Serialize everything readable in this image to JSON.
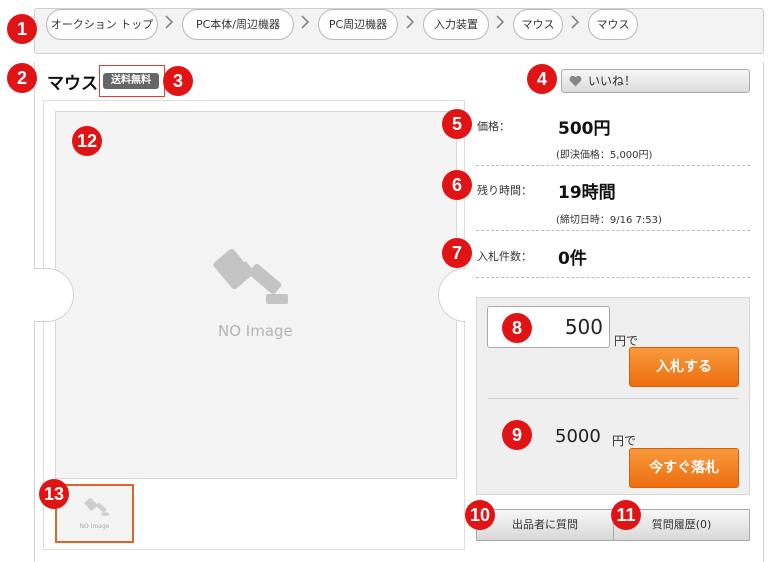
{
  "breadcrumb": [
    {
      "label": "オークション トップ"
    },
    {
      "label": "PC本体/周辺機器"
    },
    {
      "label": "PC周辺機器"
    },
    {
      "label": "入力装置"
    },
    {
      "label": "マウス"
    },
    {
      "label": "マウス"
    }
  ],
  "item": {
    "title": "マウス",
    "free_shipping_badge": "送料無料",
    "like_label": "いいね！",
    "no_image_text": "NO Image",
    "thumb_text": "NO Image"
  },
  "info": {
    "price_label": "価格：",
    "price_value": "500円",
    "price_sub": "(即決価格：5,000円)",
    "time_label": "残り時間：",
    "time_value": "19時間",
    "time_sub": "(締切日時：9/16 7:53)",
    "bids_label": "入札件数：",
    "bids_value": "0件"
  },
  "bid": {
    "input_value": "500",
    "unit": "円で",
    "bid_button": "入札する",
    "buyout_price": "5000",
    "buyout_unit": "円で",
    "buyout_button": "今すぐ落札"
  },
  "actions": {
    "question_button": "出品者に質問",
    "history_button": "質問履歴(0)"
  },
  "callouts": [
    "1",
    "2",
    "3",
    "4",
    "5",
    "6",
    "7",
    "8",
    "9",
    "10",
    "11",
    "12",
    "13"
  ],
  "colors": {
    "callout": "#e01414",
    "orange_button": "#ee6e10",
    "thumb_border": "#e0642a"
  }
}
